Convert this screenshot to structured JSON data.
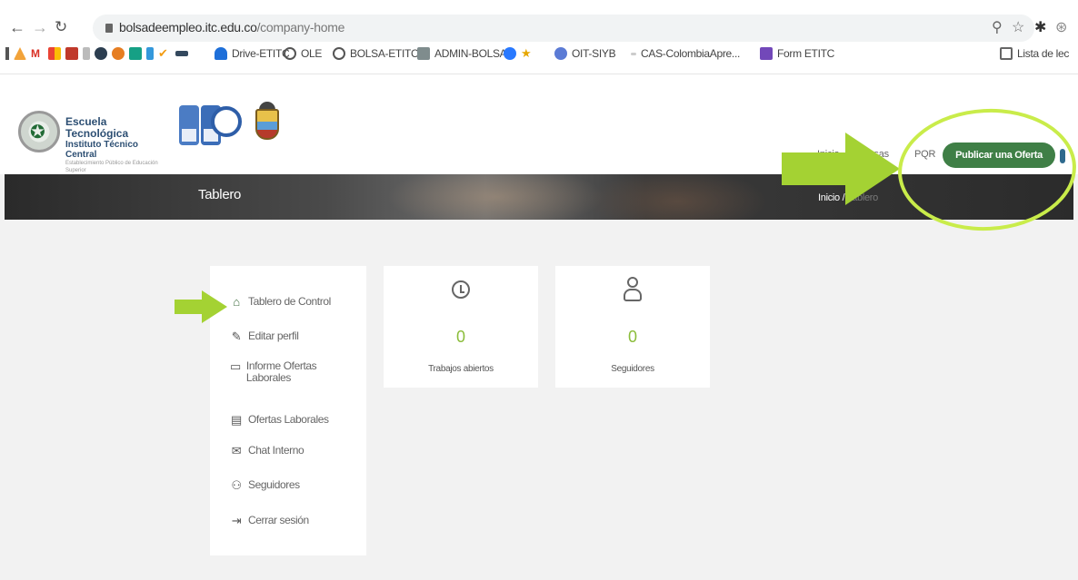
{
  "browser": {
    "url_host": "bolsadeempleo.itc.edu.co",
    "url_path": "/company-home",
    "bookmarks": [
      "Drive-ETITC",
      "OLE",
      "BOLSA-ETITC",
      "ADMIN-BOLSA",
      "OIT-SIYB",
      "CAS-ColombiaApre...",
      "Form ETITC",
      "Lista de lec"
    ]
  },
  "header": {
    "logo_line1": "Escuela Tecnológica",
    "logo_line2": "Instituto Técnico Central",
    "logo_line3": "Establecimiento Público de Educación Superior",
    "nav": {
      "inicio": "Inicio",
      "empresas": "Empresas",
      "pqr": "PQR"
    },
    "publish_button": "Publicar una Oferta"
  },
  "banner": {
    "title": "Tablero",
    "breadcrumb_home": "Inicio",
    "breadcrumb_sep": "/",
    "breadcrumb_current": "Tablero"
  },
  "sidebar": {
    "items": [
      {
        "label": "Tablero de Control",
        "icon": "dashboard-icon"
      },
      {
        "label": "Editar perfil",
        "icon": "pencil-icon"
      },
      {
        "label": "Informe Ofertas Laborales",
        "icon": "monitor-icon"
      },
      {
        "label": "Ofertas Laborales",
        "icon": "list-icon"
      },
      {
        "label": "Chat Interno",
        "icon": "mail-icon"
      },
      {
        "label": "Seguidores",
        "icon": "users-icon"
      },
      {
        "label": "Cerrar sesión",
        "icon": "logout-icon"
      }
    ]
  },
  "stats": [
    {
      "value": "0",
      "label": "Trabajos abiertos",
      "icon": "clock-icon"
    },
    {
      "value": "0",
      "label": "Seguidores",
      "icon": "user-icon"
    }
  ],
  "annotation_color": "#a4d233"
}
